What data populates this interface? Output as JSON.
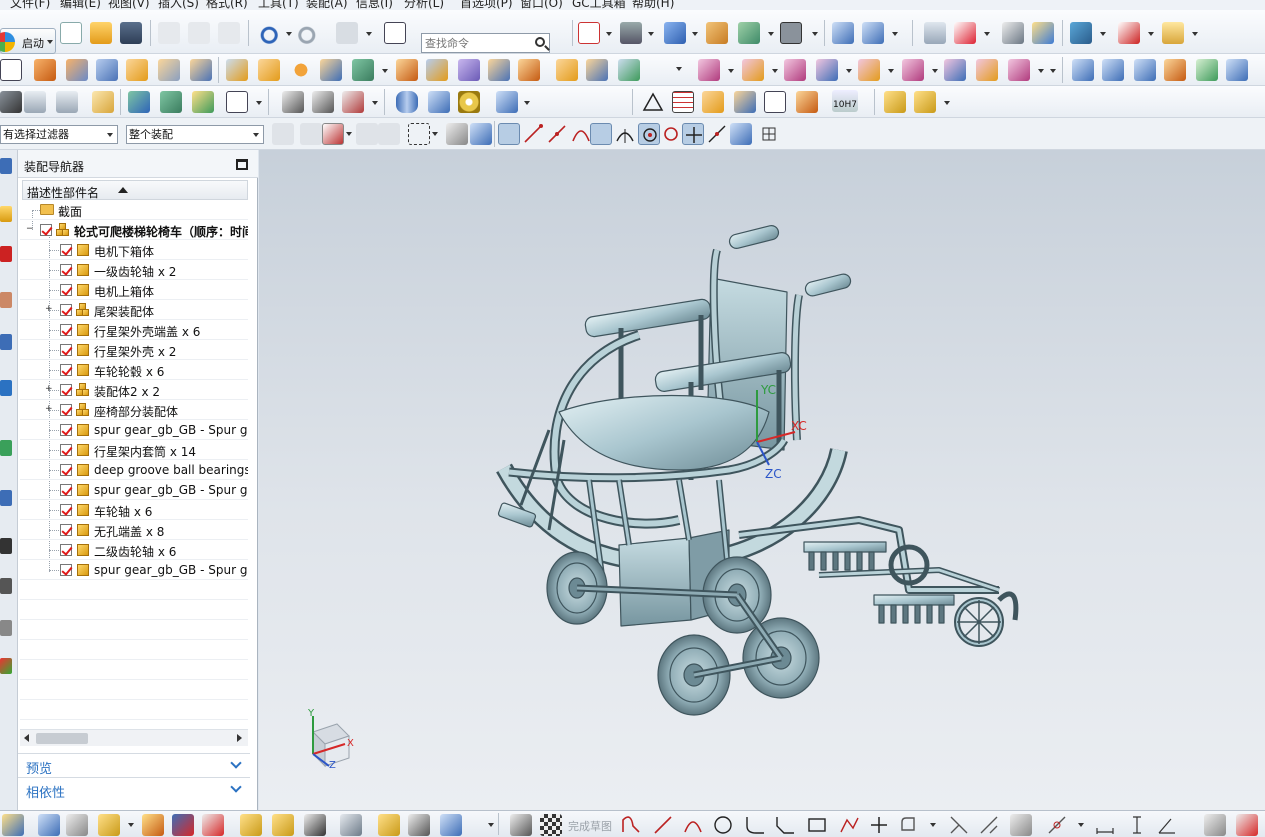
{
  "menubar": {
    "items": [
      "文件(F)",
      "编辑(E)",
      "视图(V)",
      "插入(S)",
      "格式(R)",
      "工具(T)",
      "装配(A)",
      "信息(I)",
      "分析(L)",
      "首选项(P)",
      "窗口(O)",
      "GC工具箱",
      "帮助(H)"
    ]
  },
  "toolbar": {
    "start_label": "启动",
    "search_placeholder": "查找命令",
    "filter_select": "有选择过滤器",
    "scope_select": "整个装配",
    "tolerance_label": "10H7"
  },
  "navigator": {
    "title": "装配导航器",
    "column_header": "描述性部件名",
    "section_root": "截面",
    "root_assembly": "轮式可爬楼梯轮椅车（顺序：时间",
    "items": [
      {
        "label": "电机下箱体",
        "type": "part"
      },
      {
        "label": "一级齿轮轴 x 2",
        "type": "part"
      },
      {
        "label": "电机上箱体",
        "type": "part"
      },
      {
        "label": "尾架装配体",
        "type": "assembly"
      },
      {
        "label": "行星架外壳端盖 x 6",
        "type": "part"
      },
      {
        "label": "行星架外壳 x 2",
        "type": "part"
      },
      {
        "label": "车轮轮毂 x 6",
        "type": "part"
      },
      {
        "label": "装配体2 x 2",
        "type": "assembly"
      },
      {
        "label": "座椅部分装配体",
        "type": "assembly"
      },
      {
        "label": "spur gear_gb_GB - Spur g",
        "type": "part"
      },
      {
        "label": "行星架内套筒 x 14",
        "type": "part"
      },
      {
        "label": "deep groove ball bearings",
        "type": "part"
      },
      {
        "label": "spur gear_gb_GB - Spur g",
        "type": "part"
      },
      {
        "label": "车轮轴 x 6",
        "type": "part"
      },
      {
        "label": "无孔端盖 x 8",
        "type": "part"
      },
      {
        "label": "二级齿轮轴 x 6",
        "type": "part"
      },
      {
        "label": "spur gear_gb_GB - Spur g",
        "type": "part"
      }
    ],
    "preview_label": "预览",
    "dependency_label": "相依性"
  },
  "viewport": {
    "wcs_x": "XC",
    "wcs_y": "YC",
    "wcs_z": "ZC",
    "triad_x": "X",
    "triad_y": "Y",
    "triad_z": "Z"
  },
  "bottombar": {
    "finish_sketch": "完成草图"
  },
  "colors": {
    "model": "#a9c6cf",
    "model_dark": "#4d6770",
    "link_blue": "#2b72c2",
    "check_red": "#e01818"
  }
}
